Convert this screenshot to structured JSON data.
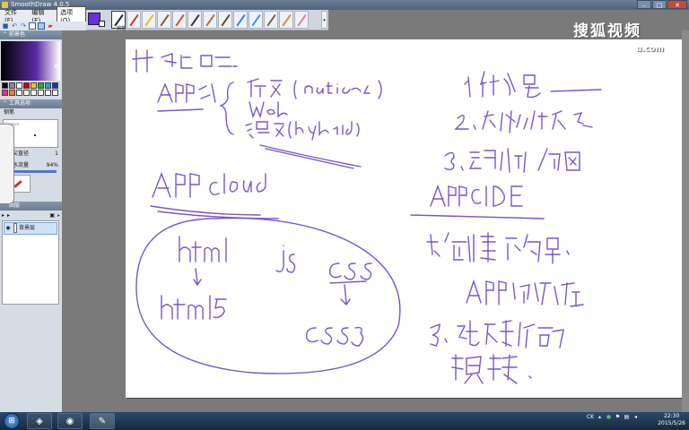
{
  "window": {
    "title": "SmoothDraw 4.0.5"
  },
  "menu": [
    {
      "label": "文件(F)"
    },
    {
      "label": "编辑(E)"
    },
    {
      "label": "选项(O)"
    }
  ],
  "toolbar": {
    "brush_label": "钢笔",
    "dropdown_icon": "▾"
  },
  "panels": {
    "color": {
      "title": "前景色"
    },
    "tool": {
      "title": "工具选项",
      "tool_name": "钢笔",
      "tip_label": "Custom",
      "tip_size_label": "笔尖直径",
      "tip_size_value": "1",
      "ink_flow_label": "墨水流量",
      "ink_flow_value": "94%",
      "mix_label": "混色"
    },
    "layers": {
      "title": "图层",
      "items": [
        {
          "name": "背景层"
        }
      ]
    }
  },
  "watermark": {
    "text": "搜狐视频",
    "sub": "u.com"
  },
  "taskbar": {
    "tray_lang": "CK",
    "time": "22:30",
    "date": "2015/5/26"
  }
}
